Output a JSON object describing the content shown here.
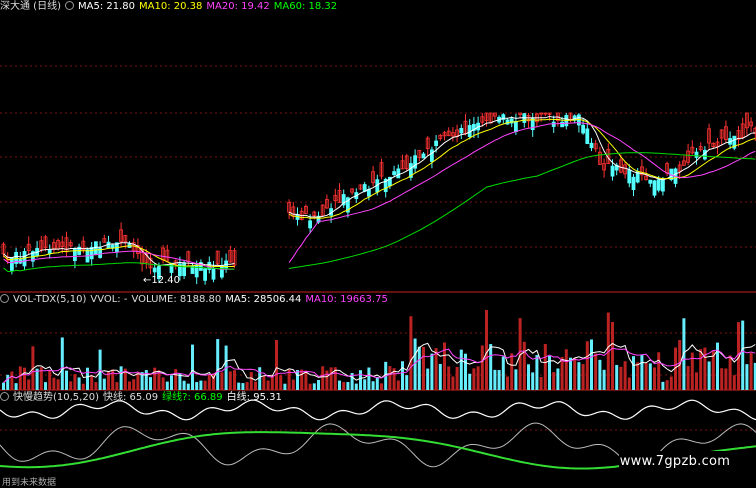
{
  "chart_data": {
    "type": "candlestick",
    "title": "深大通 (日线)",
    "ma_labels": {
      "ma5": "MA5: 21.80",
      "ma10": "MA10: 20.38",
      "ma20": "MA20: 19.42",
      "ma60": "MA60: 18.32"
    },
    "low_annotation": "←12.40",
    "vol_title": "VOL-TDX(5,10)",
    "vol_labels": {
      "vvol": "VVOL: -",
      "volume": "VOLUME: 8188.80",
      "ma5": "MA5: 28506.44",
      "ma10": "MA10: 19663.75"
    },
    "ind_labels": {
      "title": "快慢趋势(10,5,20)",
      "fast": "快线: 65.09",
      "green": "绿线?: 66.89",
      "white": "白线: 95.31"
    },
    "colors": {
      "up": "#ff3333",
      "down": "#54ffff",
      "ma5": "#ffffff",
      "ma10": "#ffff00",
      "ma20": "#ff44ff",
      "ma60": "#00dd00",
      "grid": "#7a1515",
      "divider": "#cc2020"
    }
  },
  "watermark": "www.7gpzb.com",
  "footer_text": "用到未来数据"
}
